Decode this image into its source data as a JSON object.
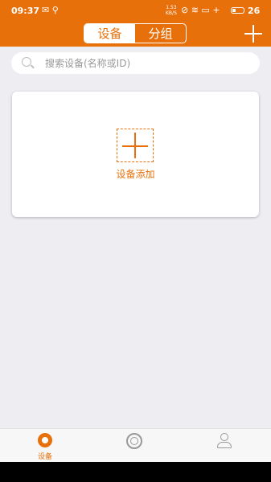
{
  "status_bar": {
    "time": "09:37",
    "network_speed": "1.53",
    "network_unit": "KB/S",
    "battery": "26"
  },
  "header": {
    "tabs": [
      {
        "label": "设备",
        "active": true
      },
      {
        "label": "分组",
        "active": false
      }
    ],
    "add_icon": "plus-icon"
  },
  "search": {
    "placeholder": "搜索设备(名称或ID)",
    "value": ""
  },
  "card": {
    "add_label": "设备添加"
  },
  "tabbar": {
    "items": [
      {
        "label": "设备",
        "icon": "camera-icon",
        "active": true
      },
      {
        "label": "",
        "icon": "group-icon",
        "active": false
      },
      {
        "label": "",
        "icon": "user-icon",
        "active": false
      }
    ]
  },
  "colors": {
    "accent": "#e8700a",
    "background": "#ededf2"
  }
}
